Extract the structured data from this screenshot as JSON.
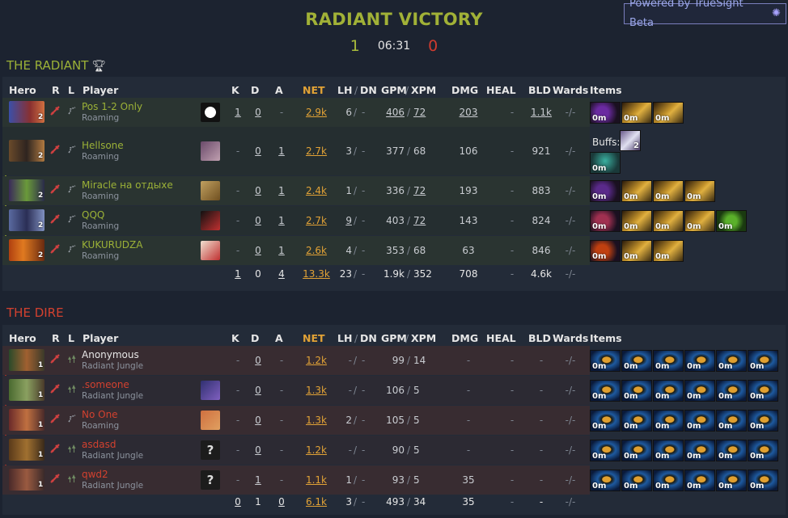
{
  "powered": {
    "label": "Powered by TrueSight Beta",
    "icon": "gem-icon"
  },
  "result": {
    "title": "RADIANT VICTORY",
    "radiant_score": "1",
    "dire_score": "0",
    "time": "06:31"
  },
  "columns": {
    "hero": "Hero",
    "r": "R",
    "l": "L",
    "player": "Player",
    "k": "K",
    "d": "D",
    "a": "A",
    "net": "NET",
    "lh": "LH",
    "dn": "DN",
    "sep": "/",
    "gpm": "GPM",
    "xpm": "XPM",
    "dmg": "DMG",
    "heal": "HEAL",
    "bld": "BLD",
    "wards": "Wards",
    "items": "Items"
  },
  "radiant": {
    "label": "THE RADIANT",
    "players": [
      {
        "name": "Pos 1-2 Only",
        "role": "Roaming",
        "level": "2",
        "k": "1",
        "d": "0",
        "a": "-",
        "net": "2.9k",
        "lh": "6",
        "dn": "-",
        "gpm": "406",
        "xpm": "72",
        "dmg": "203",
        "heal": "-",
        "bld": "1.1k",
        "wards": "-/-"
      },
      {
        "name": "Hellsone",
        "role": "Roaming",
        "level": "2",
        "k": "-",
        "d": "0",
        "a": "1",
        "net": "2.7k",
        "lh": "3",
        "dn": "-",
        "gpm": "377",
        "xpm": "68",
        "dmg": "106",
        "heal": "-",
        "bld": "921",
        "wards": "-/-"
      },
      {
        "name": "Miracle на отдыхе",
        "role": "Roaming",
        "level": "2",
        "k": "-",
        "d": "0",
        "a": "1",
        "net": "2.4k",
        "lh": "1",
        "dn": "-",
        "gpm": "336",
        "xpm": "72",
        "dmg": "193",
        "heal": "-",
        "bld": "883",
        "wards": "-/-"
      },
      {
        "name": "QQQ",
        "role": "Roaming",
        "level": "2",
        "k": "-",
        "d": "0",
        "a": "1",
        "net": "2.7k",
        "lh": "9",
        "dn": "-",
        "gpm": "403",
        "xpm": "72",
        "dmg": "143",
        "heal": "-",
        "bld": "824",
        "wards": "-/-"
      },
      {
        "name": "KUKURUDZA",
        "role": "Roaming",
        "level": "2",
        "k": "-",
        "d": "0",
        "a": "1",
        "net": "2.6k",
        "lh": "4",
        "dn": "-",
        "gpm": "353",
        "xpm": "68",
        "dmg": "63",
        "heal": "-",
        "bld": "846",
        "wards": "-/-"
      }
    ],
    "totals": {
      "k": "1",
      "d": "0",
      "a": "4",
      "net": "13.3k",
      "lh": "23",
      "dn": "-",
      "gpm": "1.9k",
      "xpm": "352",
      "dmg": "708",
      "heal": "-",
      "bld": "4.6k",
      "wards": "-/-"
    },
    "buffs_label": "Buffs:",
    "buff_count": "2",
    "item_time": "0m"
  },
  "dire": {
    "label": "THE DIRE",
    "players": [
      {
        "name": "Anonymous",
        "role": "Radiant Jungle",
        "level": "1",
        "k": "-",
        "d": "0",
        "a": "-",
        "net": "1.2k",
        "lh": "-",
        "dn": "-",
        "gpm": "99",
        "xpm": "14",
        "dmg": "-",
        "heal": "-",
        "bld": "-",
        "wards": "-/-"
      },
      {
        "name": ".someone",
        "role": "Radiant Jungle",
        "level": "1",
        "k": "-",
        "d": "0",
        "a": "-",
        "net": "1.3k",
        "lh": "-",
        "dn": "-",
        "gpm": "106",
        "xpm": "5",
        "dmg": "-",
        "heal": "-",
        "bld": "-",
        "wards": "-/-"
      },
      {
        "name": "No One",
        "role": "Roaming",
        "level": "1",
        "k": "-",
        "d": "0",
        "a": "-",
        "net": "1.3k",
        "lh": "2",
        "dn": "-",
        "gpm": "105",
        "xpm": "5",
        "dmg": "-",
        "heal": "-",
        "bld": "-",
        "wards": "-/-"
      },
      {
        "name": "asdasd",
        "role": "Radiant Jungle",
        "level": "1",
        "k": "-",
        "d": "0",
        "a": "-",
        "net": "1.2k",
        "lh": "-",
        "dn": "-",
        "gpm": "90",
        "xpm": "5",
        "dmg": "-",
        "heal": "-",
        "bld": "-",
        "wards": "-/-"
      },
      {
        "name": "qwd2",
        "role": "Radiant Jungle",
        "level": "1",
        "k": "-",
        "d": "1",
        "a": "-",
        "net": "1.1k",
        "lh": "1",
        "dn": "-",
        "gpm": "93",
        "xpm": "5",
        "dmg": "35",
        "heal": "-",
        "bld": "-",
        "wards": "-/-"
      }
    ],
    "totals": {
      "k": "0",
      "d": "1",
      "a": "0",
      "net": "6.1k",
      "lh": "3",
      "dn": "-",
      "gpm": "493",
      "xpm": "34",
      "dmg": "35",
      "heal": "-",
      "bld": "-",
      "wards": "-/-"
    }
  },
  "colors": {
    "radiant": "#9bb137",
    "dire": "#d2412f",
    "net": "#e1a236"
  }
}
